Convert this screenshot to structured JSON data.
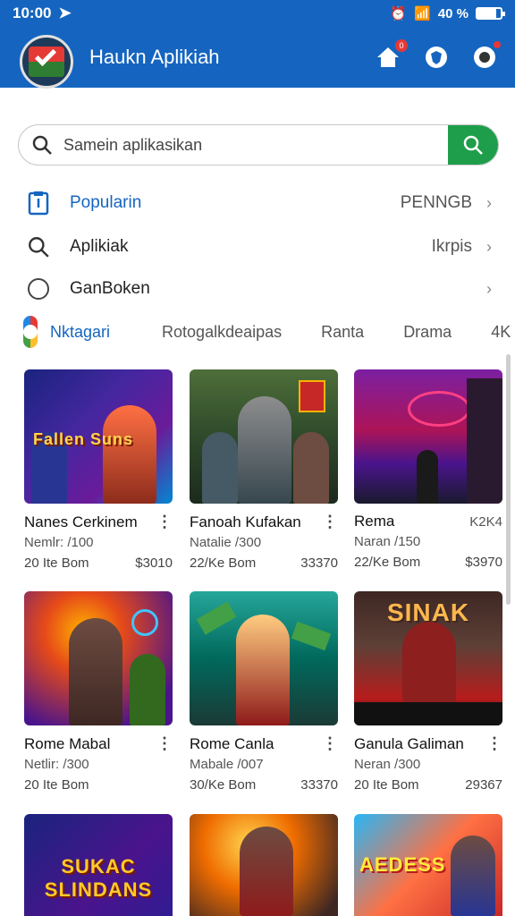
{
  "status": {
    "time": "10:00",
    "battery_text": "40 %",
    "battery_level": 0.8
  },
  "header": {
    "title": "Haukn Aplikiah",
    "notification_count": "0"
  },
  "search": {
    "placeholder": "Samein aplikasikan"
  },
  "menu": [
    {
      "icon": "document-icon",
      "label": "Popularin",
      "right": "PENNGB",
      "highlight": true
    },
    {
      "icon": "search-icon",
      "label": "Aplikiak",
      "right": "Ikrpis",
      "highlight": false
    },
    {
      "icon": "circle-icon",
      "label": "GanBoken",
      "right": "",
      "highlight": false
    }
  ],
  "tabs": [
    "Nktagari",
    "Rotogalkdeaipas",
    "Ranta",
    "Drama",
    "4K"
  ],
  "apps": [
    {
      "title": "Nanes Cerkinem",
      "extra": "",
      "sub": "Nemlr: /100",
      "meta": "20 Ite Bom",
      "price": "$3010",
      "art": "Fallen Suns"
    },
    {
      "title": "Fanoah Kufakan",
      "extra": "",
      "sub": "Natalie /300",
      "meta": "22/Ke Bom",
      "price": "33370",
      "art": ""
    },
    {
      "title": "Rema",
      "extra": "K2K4",
      "sub": "Naran /150",
      "meta": "22/Ke Bom",
      "price": "$3970",
      "art": ""
    },
    {
      "title": "Rome Mabal",
      "extra": "",
      "sub": "Netlir: /300",
      "meta": "20 Ite Bom",
      "price": "",
      "art": ""
    },
    {
      "title": "Rome Canla",
      "extra": "",
      "sub": "Mabale /007",
      "meta": "30/Ke Bom",
      "price": "33370",
      "art": ""
    },
    {
      "title": "Ganula Galiman",
      "extra": "",
      "sub": "Neran /300",
      "meta": "20 Ite Bom",
      "price": "29367",
      "art": "SINAK"
    },
    {
      "title": "",
      "extra": "",
      "sub": "",
      "meta": "",
      "price": "",
      "art": "SUKAC SLINDANS"
    },
    {
      "title": "",
      "extra": "",
      "sub": "",
      "meta": "",
      "price": "",
      "art": ""
    },
    {
      "title": "",
      "extra": "",
      "sub": "",
      "meta": "",
      "price": "",
      "art": "AEDESS"
    }
  ],
  "colors": {
    "primary": "#1565c0",
    "accent_green": "#1e9e4a"
  }
}
